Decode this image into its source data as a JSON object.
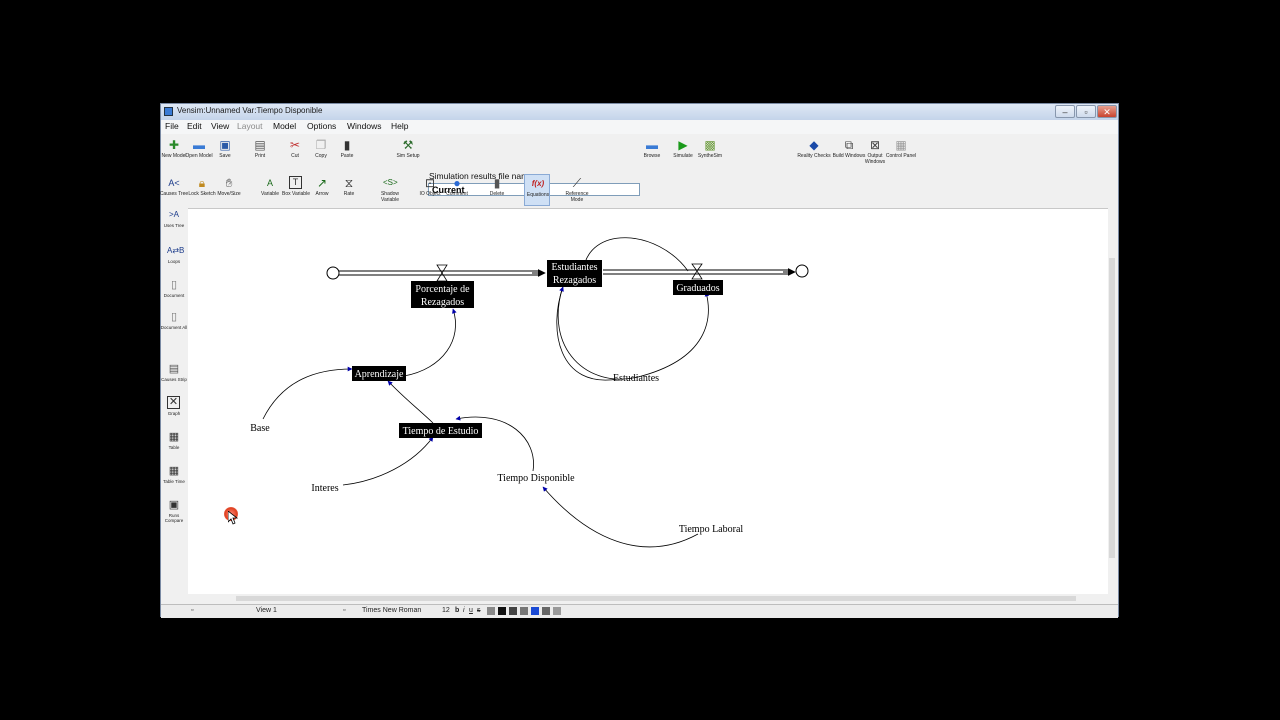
{
  "window": {
    "title": "Vensim:Unnamed Var:Tiempo Disponible"
  },
  "menubar": [
    {
      "label": "File",
      "disabled": false
    },
    {
      "label": "Edit",
      "disabled": false
    },
    {
      "label": "View",
      "disabled": false
    },
    {
      "label": "Layout",
      "disabled": true
    },
    {
      "label": "Model",
      "disabled": false
    },
    {
      "label": "Options",
      "disabled": false
    },
    {
      "label": "Windows",
      "disabled": false
    },
    {
      "label": "Help",
      "disabled": false
    }
  ],
  "toolbar": {
    "new_model": "New Model",
    "open_model": "Open Model",
    "save": "Save",
    "print": "Print",
    "cut": "Cut",
    "copy": "Copy",
    "paste": "Paste",
    "sim_setup": "Sim Setup",
    "sim_results_label": "Simulation results file name",
    "sim_results_value": "Current",
    "browse": "Browse",
    "simulate": "Simulate",
    "synthesim": "SyntheSim",
    "reality_checks": "Reality Checks",
    "build_windows": "Build Windows",
    "output_windows": "Output Windows",
    "control_panel": "Control Panel"
  },
  "sketch_tools": {
    "causes_tree": "Causes Tree",
    "lock_sketch": "Lock Sketch",
    "move_size": "Move/Size",
    "variable": "Variable",
    "box_variable": "Box Variable",
    "arrow": "Arrow",
    "rate": "Rate",
    "shadow_variable": "Shadow Variable",
    "io_object": "IO Object",
    "comment": "Comment",
    "delete": "Delete",
    "equations": "Equations",
    "reference_mode": "Reference Mode"
  },
  "analysis_tools": {
    "uses_tree": "Uses Tree",
    "loops": "Loops",
    "document": "Document",
    "document_all": "Document All",
    "causes_strip": "Causes Strip",
    "graph": "Graph",
    "table": "Table",
    "table_time": "Table Time",
    "runs_compare": "Runs Compare"
  },
  "diagram": {
    "nodes": {
      "estudiantes_rezagados_l1": "Estudiantes",
      "estudiantes_rezagados_l2": "Rezagados",
      "porcentaje_l1": "Porcentaje de",
      "porcentaje_l2": "Rezagados",
      "graduados": "Graduados",
      "estudiantes": "Estudiantes",
      "aprendizaje": "Aprendizaje",
      "base": "Base",
      "tiempo_de_estudio": "Tiempo de Estudio",
      "interes": "Interes",
      "tiempo_disponible": "Tiempo Disponible",
      "tiempo_laboral": "Tiempo Laboral"
    },
    "colors": {
      "arrow": "#0000aa",
      "highlight_bg": "#000000",
      "highlight_text": "#ffffff"
    }
  },
  "statusbar": {
    "view": "View 1",
    "font": "Times New Roman",
    "size": "12",
    "bold": "b",
    "italic": "i",
    "underline": "u",
    "strike": "s"
  }
}
